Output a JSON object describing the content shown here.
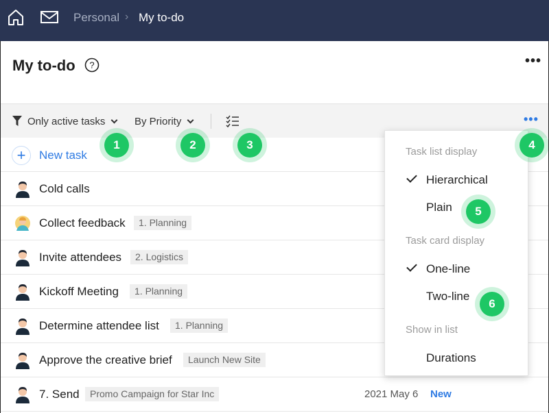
{
  "topbar": {
    "home_icon": "home-icon",
    "mail_icon": "mail-icon",
    "breadcrumb_parent": "Personal",
    "breadcrumb_separator": "›",
    "breadcrumb_current": "My to-do"
  },
  "header": {
    "title": "My to-do",
    "help_icon": "help-circle-icon",
    "more_label": "•••"
  },
  "toolbar": {
    "filter_label": "Only active tasks",
    "sort_label": "By Priority",
    "checklist_icon": "checklist-icon",
    "more_label": "•••"
  },
  "new_task": {
    "plus": "+",
    "label": "New task"
  },
  "tasks": [
    {
      "name": "Cold calls",
      "tag": "",
      "date": "",
      "status": ""
    },
    {
      "name": "Collect feedback",
      "tag": "1. Planning",
      "date": "",
      "status": ""
    },
    {
      "name": "Invite attendees",
      "tag": "2. Logistics",
      "date": "",
      "status": ""
    },
    {
      "name": "Kickoff Meeting",
      "tag": "1. Planning",
      "date": "",
      "status": ""
    },
    {
      "name": "Determine attendee list",
      "tag": "1. Planning",
      "date": "",
      "status": ""
    },
    {
      "name": "Approve the creative brief",
      "tag": "Launch New Site",
      "date": "",
      "status": ""
    },
    {
      "name": "7. Send",
      "tag": "Promo Campaign for Star Inc",
      "date": "2021 May 6",
      "status": "New"
    }
  ],
  "dropdown": {
    "section_list_display": "Task list display",
    "hierarchical": "Hierarchical",
    "plain": "Plain",
    "section_card_display": "Task card display",
    "one_line": "One-line",
    "two_line": "Two-line",
    "section_show_in_list": "Show in list",
    "durations": "Durations",
    "selected": [
      "Hierarchical",
      "One-line"
    ]
  },
  "badges": [
    "1",
    "2",
    "3",
    "4",
    "5",
    "6"
  ],
  "colors": {
    "topbar": "#2a3553",
    "accent": "#2f7be3",
    "badge": "#1ec765"
  }
}
